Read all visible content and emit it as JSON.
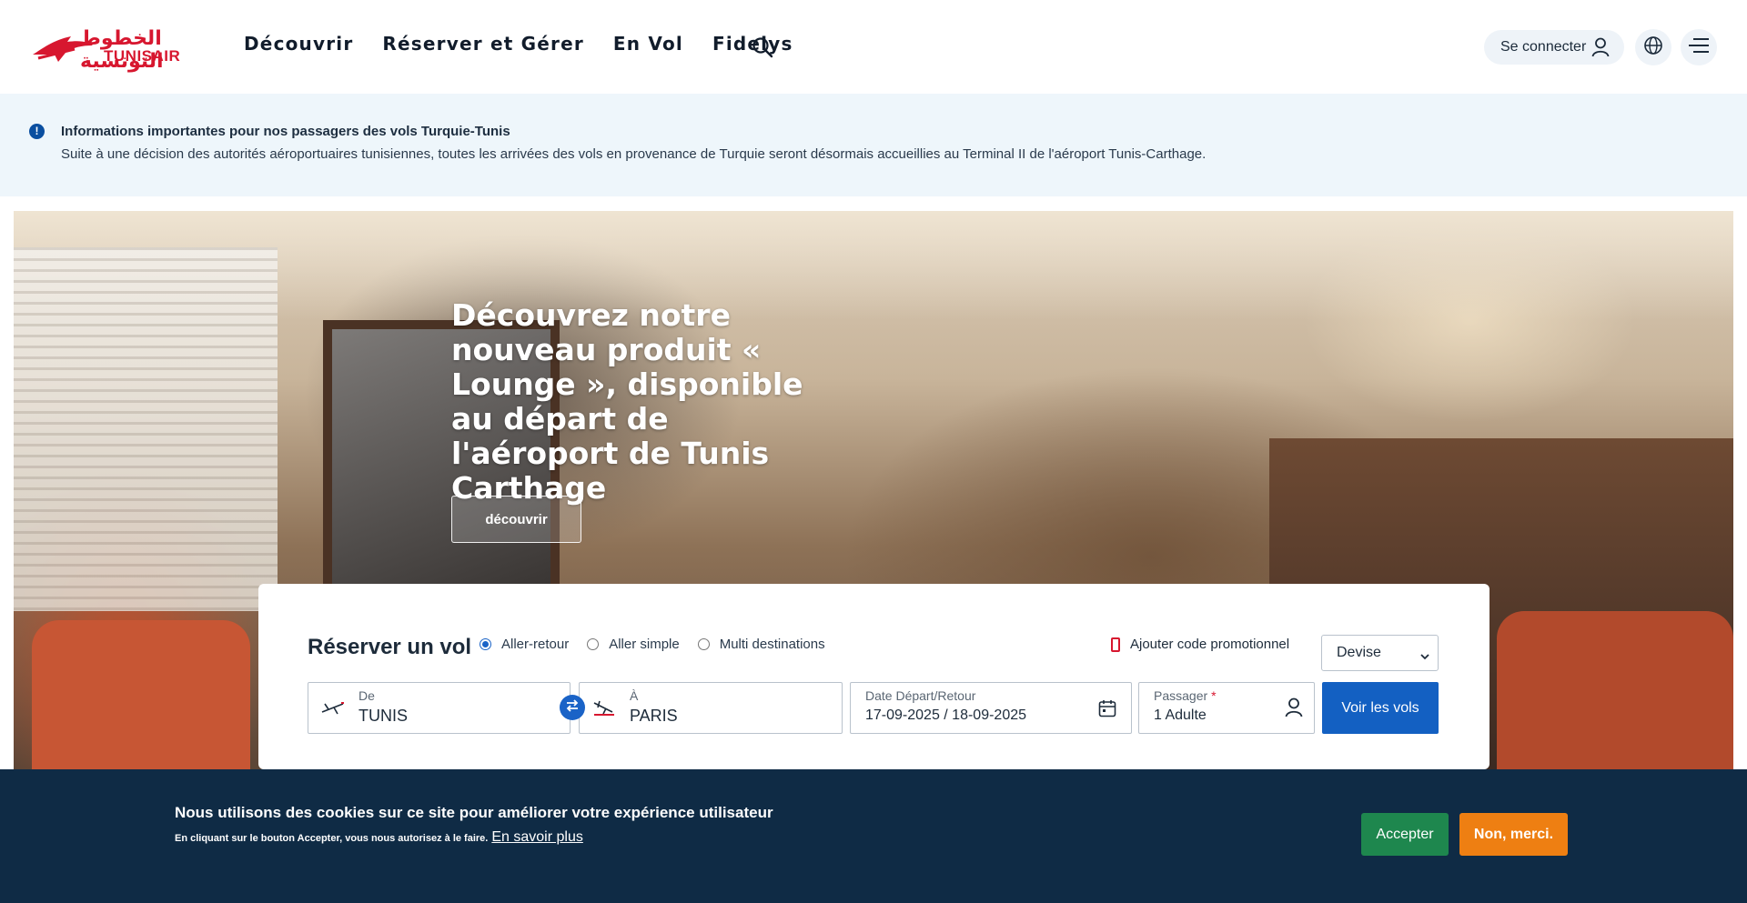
{
  "header": {
    "logo_arabic": "الخطوط التونسية",
    "logo_latin": "TUNISAIR",
    "nav": [
      "Découvrir",
      "Réserver et Gérer",
      "En Vol",
      "Fidelys"
    ],
    "login_label": "Se connecter",
    "icons": {
      "search": "search-icon",
      "user": "user-icon",
      "language": "globe-icon",
      "menu": "menu-icon"
    }
  },
  "info": {
    "title": "Informations importantes pour nos passagers des vols Turquie-Tunis",
    "text": "Suite à une décision des autorités aéroportuaires tunisiennes, toutes les arrivées des vols en provenance de Turquie seront désormais accueillies au Terminal II de l'aéroport Tunis-Carthage."
  },
  "hero": {
    "title": "Découvrez notre nouveau produit « Lounge », disponible au départ de l'aéroport de Tunis Carthage",
    "button": "découvrir"
  },
  "booking": {
    "title": "Réserver un vol",
    "trip_types": [
      {
        "label": "Aller-retour",
        "selected": true
      },
      {
        "label": "Aller simple",
        "selected": false
      },
      {
        "label": "Multi destinations",
        "selected": false
      }
    ],
    "promo_label": "Ajouter code promotionnel",
    "currency_placeholder": "Devise",
    "from": {
      "label": "De",
      "value": "TUNIS"
    },
    "to": {
      "label": "À",
      "value": "PARIS"
    },
    "dates": {
      "label": "Date Départ/Retour",
      "value": "17-09-2025 / 18-09-2025"
    },
    "passengers": {
      "label": "Passager",
      "required_mark": "*",
      "value": "1 Adulte"
    },
    "submit": "Voir les vols"
  },
  "cookie": {
    "title": "Nous utilisons des cookies sur ce site pour améliorer votre expérience utilisateur",
    "text": "En cliquant sur le bouton Accepter, vous nous autorisez à le faire.",
    "link": "En savoir plus",
    "accept": "Accepter",
    "refuse": "Non, merci."
  },
  "colors": {
    "brand_red": "#d7172f",
    "primary_blue": "#1360c2",
    "cookie_bg": "#0f2b45",
    "accept_green": "#1e874e",
    "refuse_orange": "#ee7f12",
    "info_bg": "#eef6fb"
  }
}
